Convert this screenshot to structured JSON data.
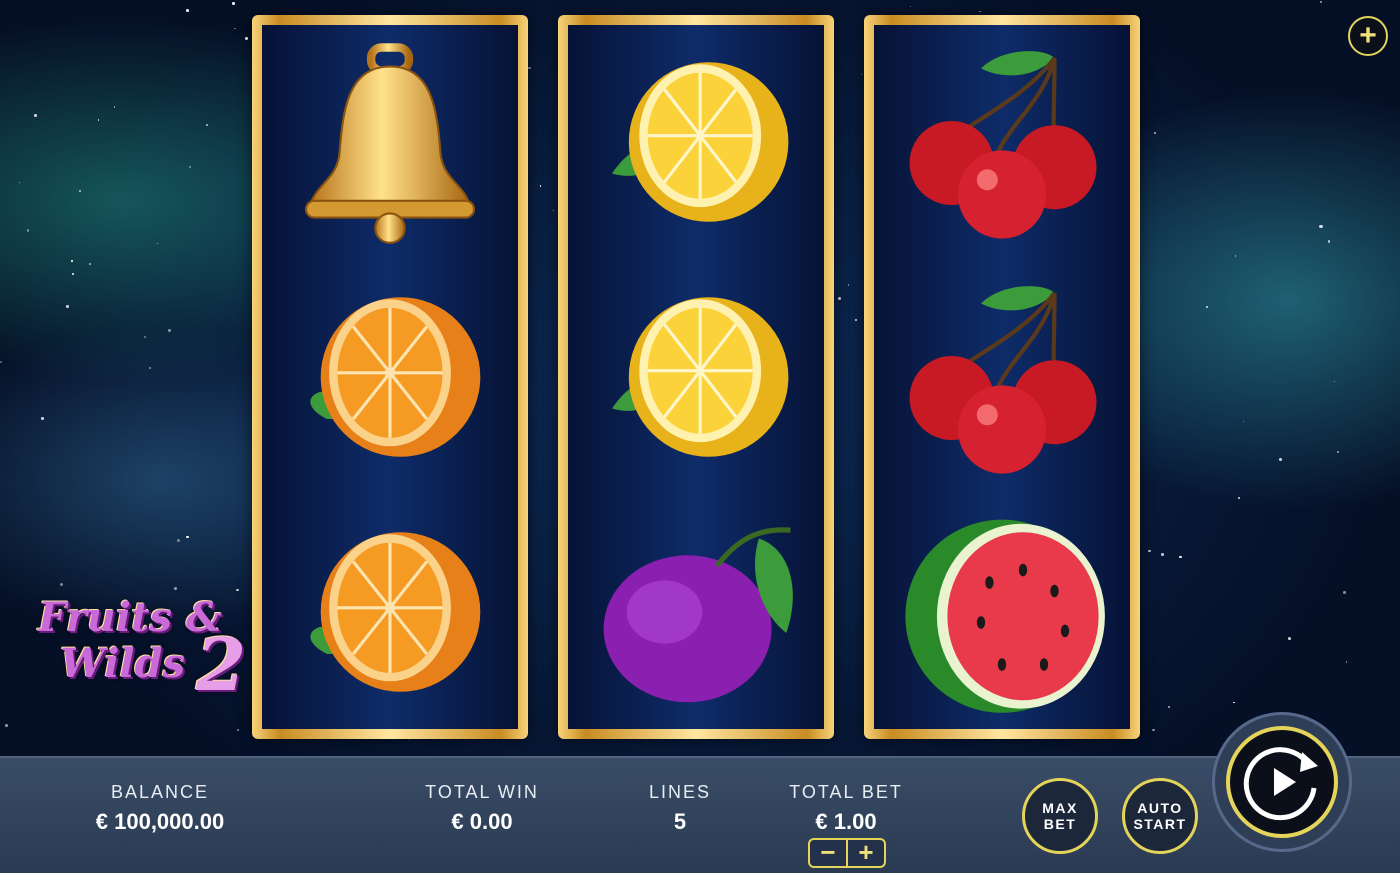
{
  "game": {
    "logo_line1": "Fruits &",
    "logo_line2": "Wilds",
    "logo_number": "2"
  },
  "reels": [
    [
      "bell-icon",
      "orange-icon",
      "orange-icon"
    ],
    [
      "lemon-icon",
      "lemon-icon",
      "plum-icon"
    ],
    [
      "cherries-icon",
      "cherries-icon",
      "watermelon-icon"
    ]
  ],
  "top_controls": {
    "menu_icon": "plus-icon",
    "menu_glyph": "+"
  },
  "bottom_bar": {
    "balance_label": "BALANCE",
    "balance_value": "€ 100,000.00",
    "total_win_label": "TOTAL WIN",
    "total_win_value": "€ 0.00",
    "lines_label": "LINES",
    "lines_value": "5",
    "total_bet_label": "TOTAL BET",
    "total_bet_value": "€ 1.00",
    "bet_minus": "−",
    "bet_plus": "+",
    "max_bet_line1": "MAX",
    "max_bet_line2": "BET",
    "auto_start_line1": "AUTO",
    "auto_start_line2": "START",
    "spin_icon": "spin-icon"
  },
  "colors": {
    "accent": "#e4d45a",
    "bar_bg": "#2a3a52",
    "reel_frame": "#c98b22"
  }
}
